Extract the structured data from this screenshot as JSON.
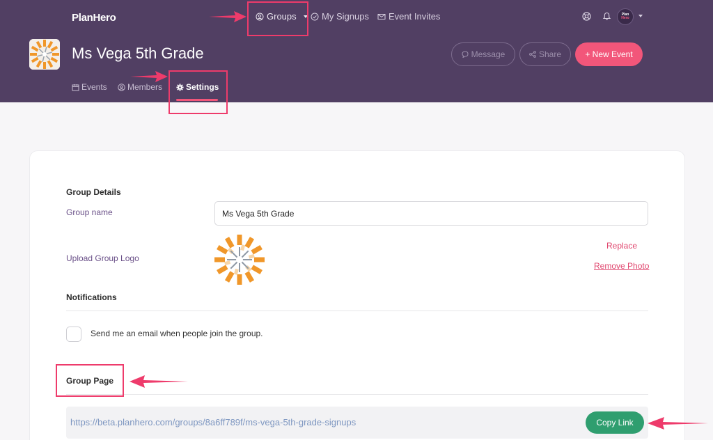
{
  "header": {
    "brand": "PlanHero",
    "nav": {
      "groups": "Groups",
      "my_signups": "My Signups",
      "event_invites": "Event Invites"
    },
    "avatar": {
      "line1": "Plan",
      "line2": "Hero"
    }
  },
  "group": {
    "title": "Ms Vega 5th Grade",
    "actions": {
      "message": "Message",
      "share": "Share",
      "new_event": "+ New Event"
    },
    "tabs": {
      "events": "Events",
      "members": "Members",
      "settings": "Settings"
    }
  },
  "settings": {
    "group_details_title": "Group Details",
    "group_name_label": "Group name",
    "group_name_value": "Ms Vega 5th Grade",
    "upload_logo_label": "Upload Group Logo",
    "replace": "Replace",
    "remove_photo": "Remove Photo",
    "notifications_title": "Notifications",
    "notify_join_label": "Send me an email when people join the group.",
    "group_page_title": "Group Page",
    "group_page_url": "https://beta.planhero.com/groups/8a6ff789f/ms-vega-5th-grade-signups",
    "copy_link": "Copy Link"
  },
  "colors": {
    "header_bg": "#513f63",
    "accent_pink": "#f2567a",
    "copy_green": "#2f9e6f",
    "annotation": "#ee3b6b"
  },
  "icons": [
    "user-circle-icon",
    "check-circle-icon",
    "mail-icon",
    "help-icon",
    "bell-icon",
    "chat-icon",
    "share-icon",
    "calendar-icon",
    "gear-icon"
  ]
}
